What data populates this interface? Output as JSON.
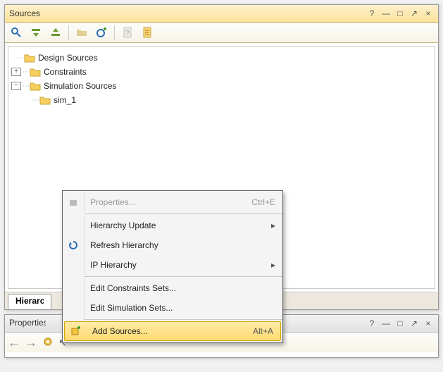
{
  "sources": {
    "title": "Sources",
    "tree": {
      "design": "Design Sources",
      "constraints": "Constraints",
      "simulation": "Simulation Sources",
      "sim1": "sim_1"
    },
    "tab": "Hierarchy"
  },
  "properties": {
    "title": "Properties"
  },
  "ctx": {
    "properties": "Properties...",
    "properties_key": "Ctrl+E",
    "hier_update": "Hierarchy Update",
    "refresh": "Refresh Hierarchy",
    "ip_hier": "IP Hierarchy",
    "edit_constr": "Edit Constraints Sets...",
    "edit_sim": "Edit Simulation Sets...",
    "add_src": "Add Sources...",
    "add_src_key": "Alt+A"
  }
}
